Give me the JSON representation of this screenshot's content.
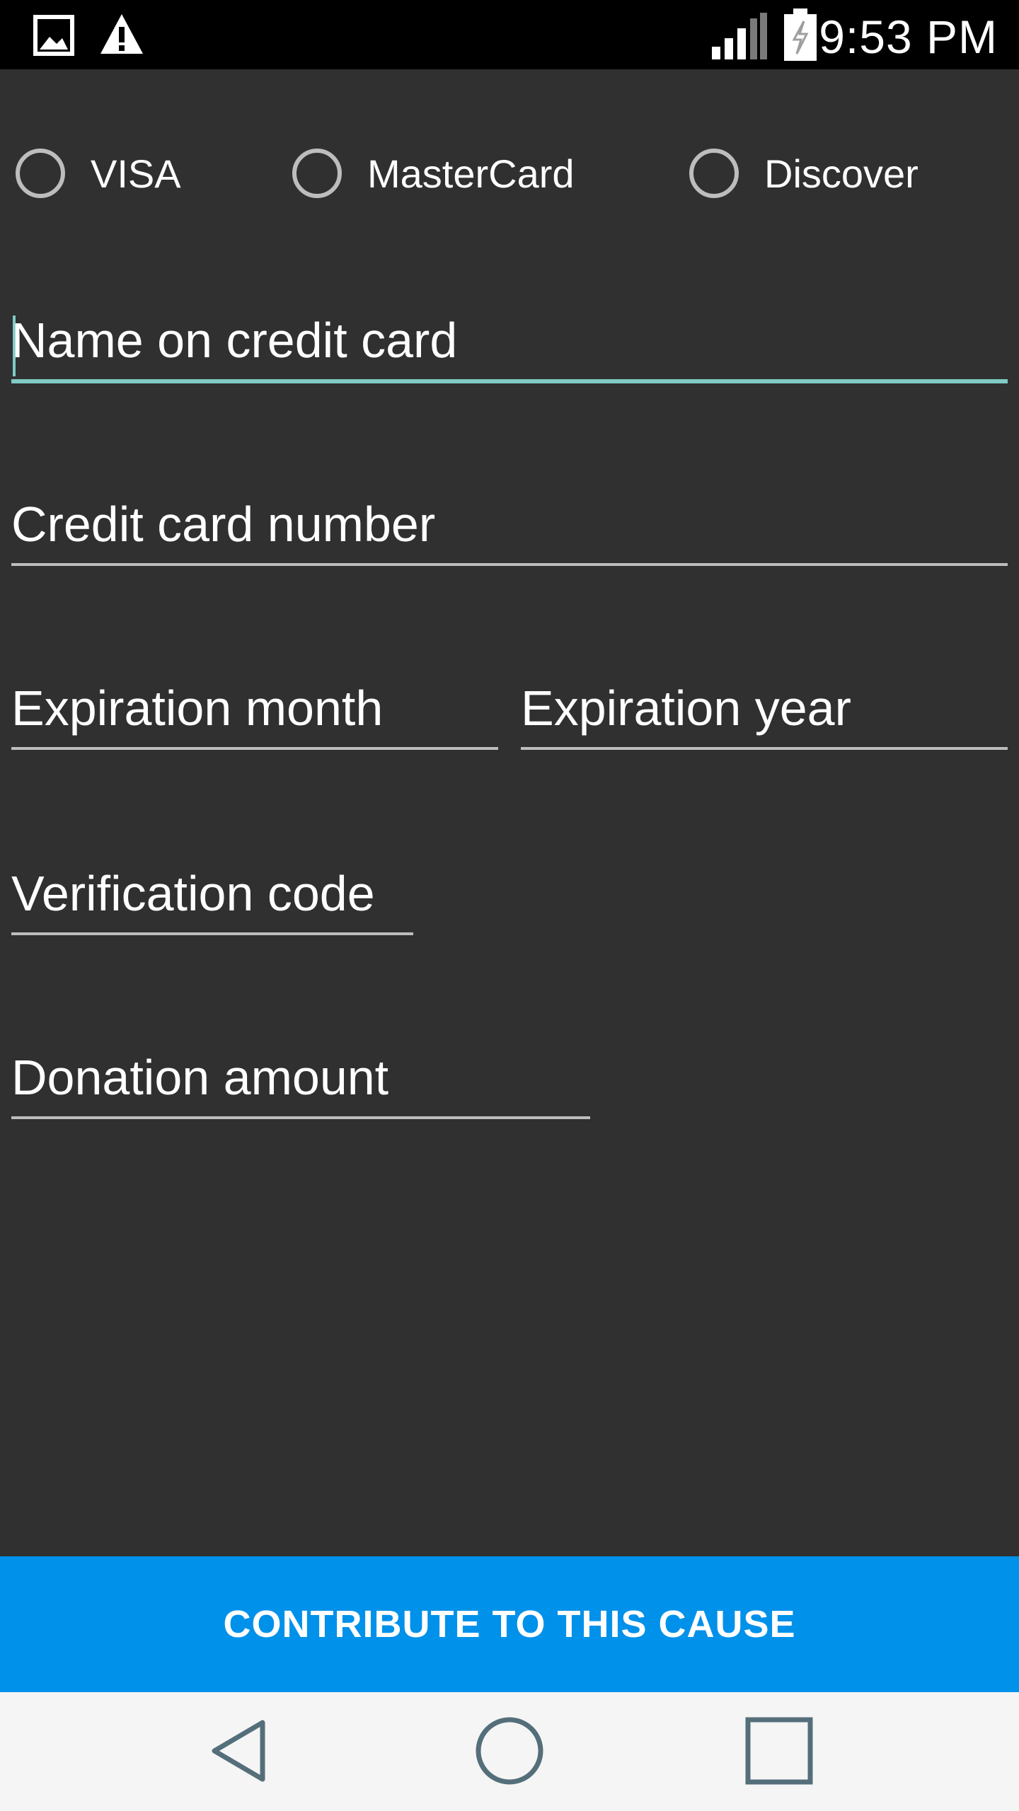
{
  "status_bar": {
    "time": "9:53 PM",
    "left_icons": [
      "image-icon",
      "warning-icon"
    ],
    "right_icons": [
      "signal-icon",
      "battery-charging-icon"
    ]
  },
  "card_type": {
    "options": [
      {
        "label": "VISA",
        "selected": false
      },
      {
        "label": "MasterCard",
        "selected": false
      },
      {
        "label": "Discover",
        "selected": false
      }
    ]
  },
  "form": {
    "name_on_card": {
      "placeholder": "Name on credit card",
      "value": ""
    },
    "card_number": {
      "placeholder": "Credit card number",
      "value": ""
    },
    "exp_month": {
      "placeholder": "Expiration month",
      "value": ""
    },
    "exp_year": {
      "placeholder": "Expiration year",
      "value": ""
    },
    "verification_code": {
      "placeholder": "Verification code",
      "value": ""
    },
    "donation_amount": {
      "placeholder": "Donation amount",
      "value": ""
    }
  },
  "actions": {
    "contribute_label": "CONTRIBUTE TO THIS CAUSE"
  },
  "nav_bar": {
    "buttons": [
      "back-icon",
      "home-icon",
      "recents-icon"
    ]
  },
  "colors": {
    "background": "#303030",
    "accent": "#80cbc4",
    "button": "#0091ea"
  }
}
